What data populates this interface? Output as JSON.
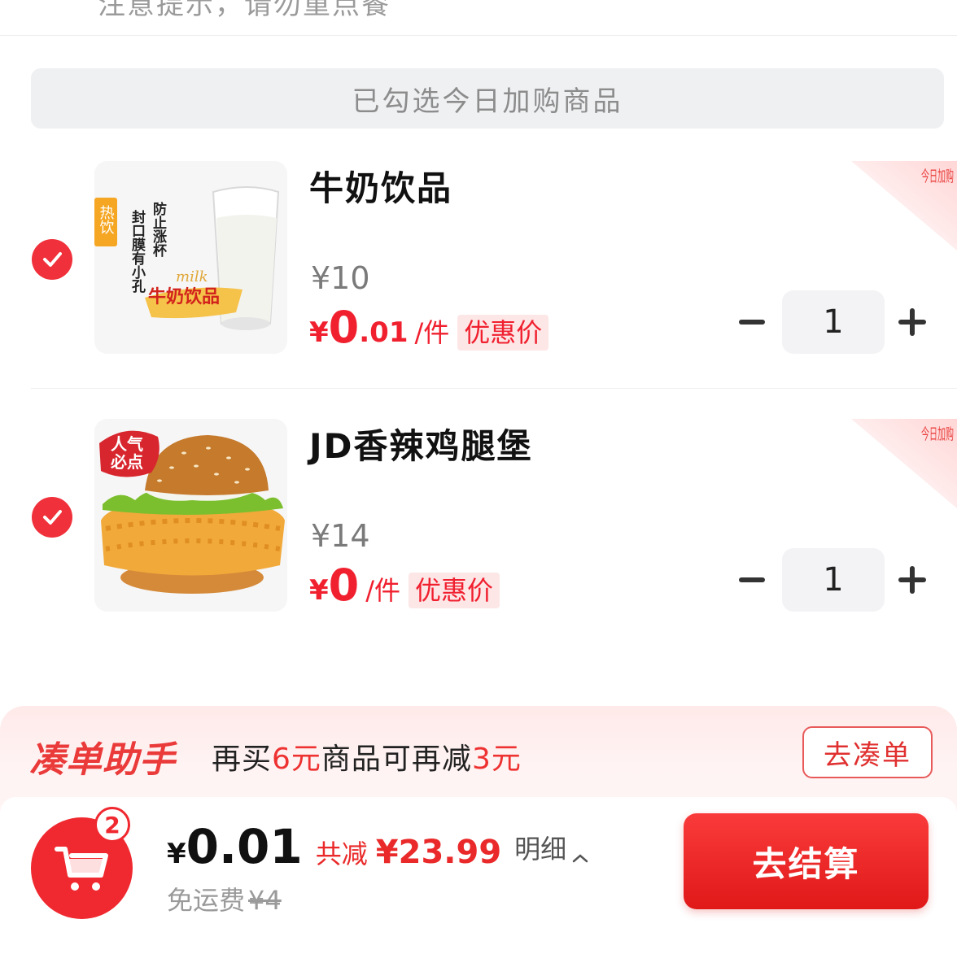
{
  "top_clipped_text": "注意提示，请勿重点餐",
  "section_header": "已勾选今日加购商品",
  "ribbon_text": "今日加购",
  "items": [
    {
      "name": "牛奶饮品",
      "original_price": "¥10",
      "price_currency": "¥",
      "price_int": "0",
      "price_dec": ".01",
      "unit": "/件",
      "tag": "优惠价",
      "quantity": "1",
      "checked": true,
      "image": {
        "badge": "热饮",
        "side_text_1": "防止涨杯",
        "side_text_2": "封口膜有小孔",
        "script_text": "milk",
        "logo_text": "牛奶饮品"
      }
    },
    {
      "name": "JD香辣鸡腿堡",
      "original_price": "¥14",
      "price_currency": "¥",
      "price_int": "0",
      "price_dec": "",
      "unit": "/件",
      "tag": "优惠价",
      "quantity": "1",
      "checked": true,
      "image": {
        "badge_line1": "人气",
        "badge_line2": "必点"
      }
    }
  ],
  "helper": {
    "title": "凑单助手",
    "text_1": "再买",
    "amount_1": "6元",
    "text_2": "商品可再减",
    "amount_2": "3元",
    "button": "去凑单"
  },
  "footer": {
    "cart_count": "2",
    "total_currency": "¥",
    "total": "0.01",
    "discount_label": "共减",
    "discount_value": "¥23.99",
    "detail_label": "明细",
    "shipping_label": "免运费",
    "shipping_original": "¥4",
    "checkout_label": "去结算"
  },
  "colors": {
    "accent": "#f0282f",
    "helper_bg": "#ffe9e9",
    "tag_bg": "#fde6e6"
  },
  "icons": [
    "check-icon",
    "cart-icon",
    "minus-icon",
    "plus-icon",
    "chevron-up-icon"
  ]
}
